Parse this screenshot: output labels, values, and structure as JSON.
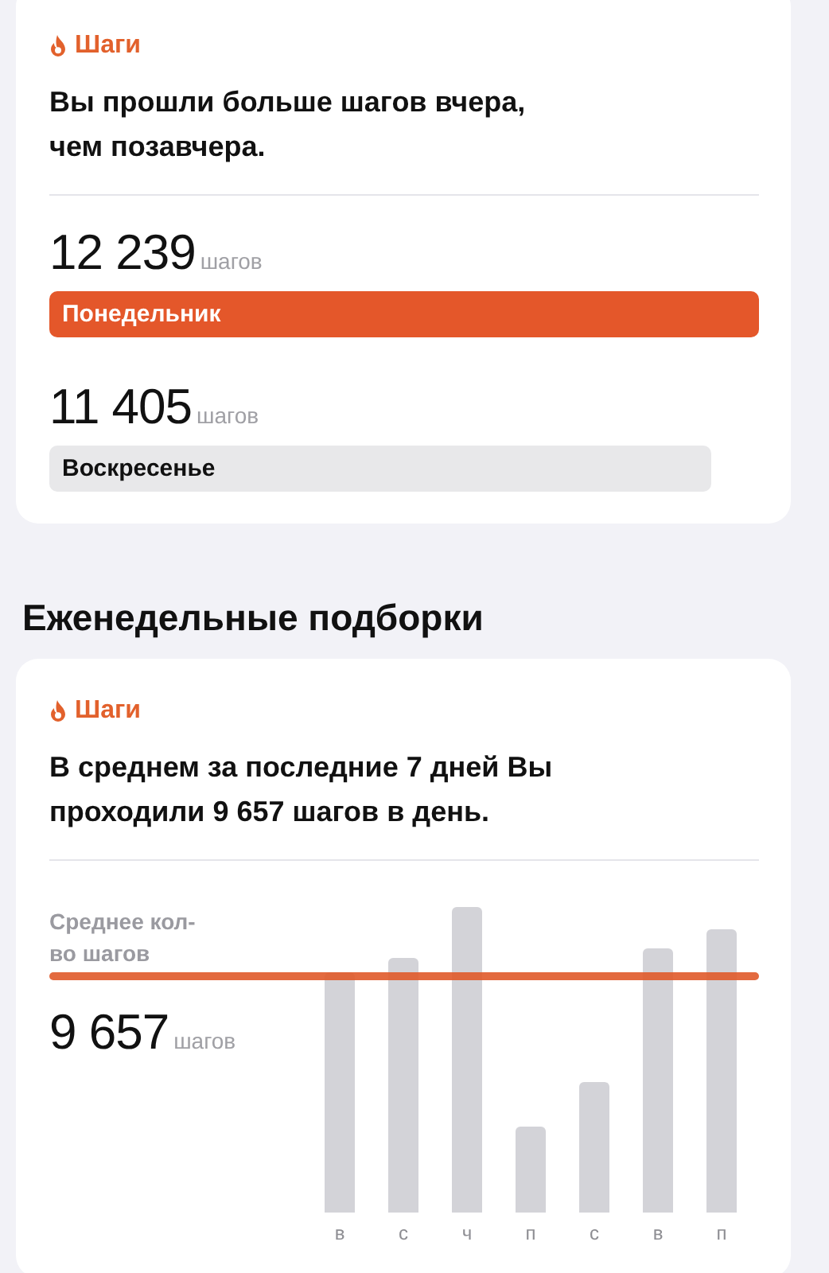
{
  "highlight_card": {
    "category": "Шаги",
    "message": "Вы прошли больше шагов вчера, чем позавчера.",
    "comparisons": [
      {
        "value": "12 239",
        "unit": "шагов",
        "day": "Понедельник",
        "highlighted": true
      },
      {
        "value": "11 405",
        "unit": "шагов",
        "day": "Воскресенье",
        "highlighted": false
      }
    ]
  },
  "section_title": "Еженедельные подборки",
  "weekly_card": {
    "category": "Шаги",
    "message": "В среднем за последние 7 дней Вы проходили 9 657 шагов в день.",
    "average_label": "Среднее кол-во шагов",
    "average_value": "9 657",
    "average_unit": "шагов",
    "days": [
      "в",
      "с",
      "ч",
      "п",
      "с",
      "в",
      "п"
    ]
  }
}
